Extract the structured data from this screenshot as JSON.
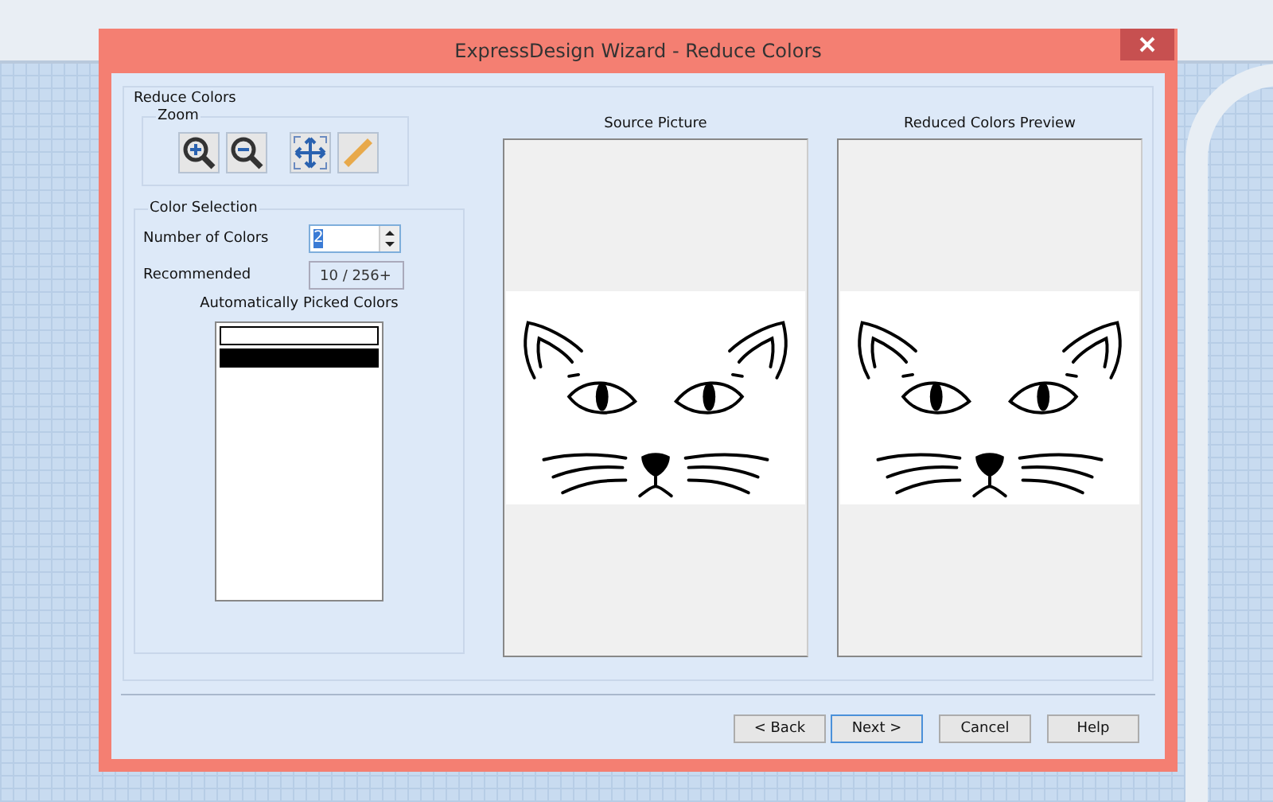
{
  "window": {
    "title": "ExpressDesign Wizard - Reduce Colors"
  },
  "group": {
    "title": "Reduce Colors"
  },
  "zoom": {
    "title": "Zoom"
  },
  "color_selection": {
    "title": "Color Selection",
    "number_label": "Number of Colors",
    "number_value": "2",
    "recommended_label": "Recommended",
    "recommended_value": "10 / 256+",
    "picked_title": "Automatically Picked Colors",
    "picked_colors": [
      {
        "color": "#ffffff"
      },
      {
        "color": "#000000"
      }
    ]
  },
  "previews": [
    {
      "title": "Source Picture"
    },
    {
      "title": "Reduced Colors Preview"
    }
  ],
  "buttons": [
    {
      "label": "< Back",
      "default": false
    },
    {
      "label": "Next >",
      "default": true
    },
    {
      "label": "Cancel",
      "default": false
    },
    {
      "label": "Help",
      "default": false
    }
  ]
}
